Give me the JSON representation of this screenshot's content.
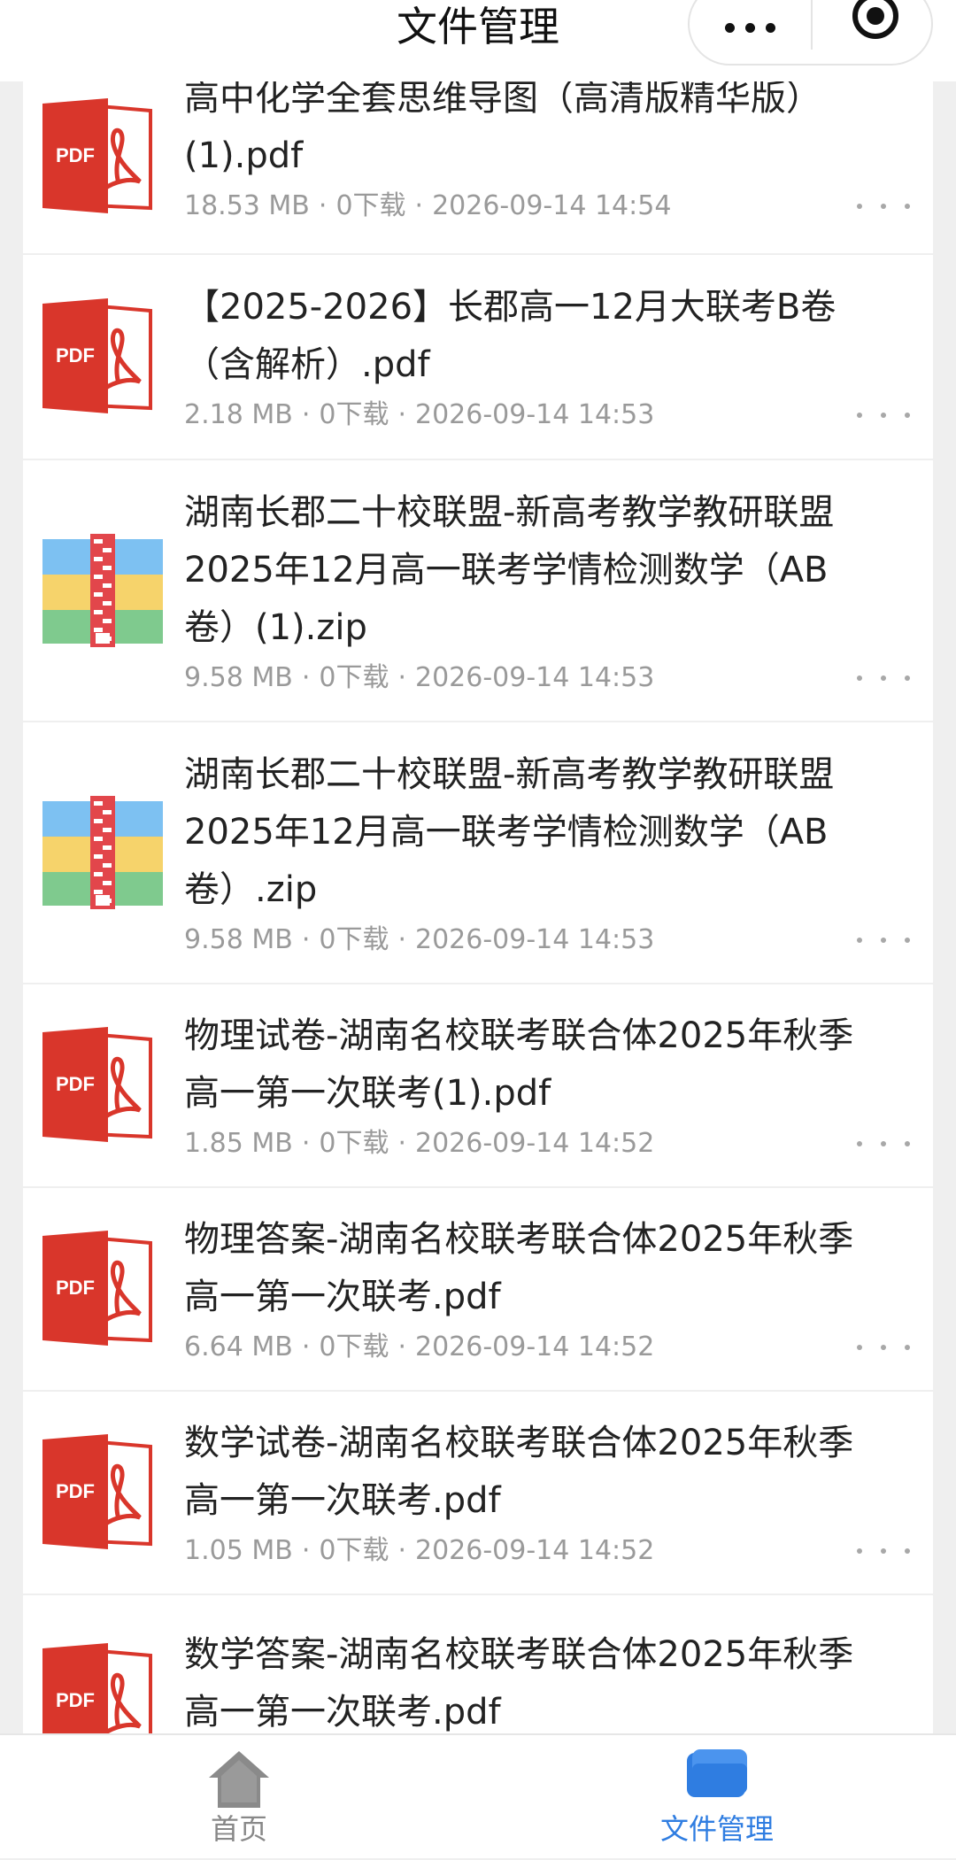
{
  "header": {
    "title": "文件管理",
    "menu_icon": "more-dots-icon",
    "close_icon": "target-circle-icon"
  },
  "files": [
    {
      "name_line1": "高中化学全套思维导图（高清版精华版）",
      "name_line2": "(1).pdf",
      "name_line3": "",
      "size": "18.53 MB",
      "downloads": "0下载",
      "datetime": "2026-09-14 14:54",
      "type": "pdf"
    },
    {
      "name_line1": "【2025-2026】长郡高一12月大联考B卷",
      "name_line2": "（含解析）.pdf",
      "name_line3": "",
      "size": "2.18 MB",
      "downloads": "0下载",
      "datetime": "2026-09-14 14:53",
      "type": "pdf"
    },
    {
      "name_line1": "湖南长郡二十校联盟-新高考教学教研联盟",
      "name_line2": "2025年12月高一联考学情检测数学（AB",
      "name_line3": "卷）(1).zip",
      "size": "9.58 MB",
      "downloads": "0下载",
      "datetime": "2026-09-14 14:53",
      "type": "zip"
    },
    {
      "name_line1": "湖南长郡二十校联盟-新高考教学教研联盟",
      "name_line2": "2025年12月高一联考学情检测数学（AB",
      "name_line3": "卷）.zip",
      "size": "9.58 MB",
      "downloads": "0下载",
      "datetime": "2026-09-14 14:53",
      "type": "zip"
    },
    {
      "name_line1": "物理试卷-湖南名校联考联合体2025年秋季",
      "name_line2": "高一第一次联考(1).pdf",
      "name_line3": "",
      "size": "1.85 MB",
      "downloads": "0下载",
      "datetime": "2026-09-14 14:52",
      "type": "pdf"
    },
    {
      "name_line1": "物理答案-湖南名校联考联合体2025年秋季",
      "name_line2": "高一第一次联考.pdf",
      "name_line3": "",
      "size": "6.64 MB",
      "downloads": "0下载",
      "datetime": "2026-09-14 14:52",
      "type": "pdf"
    },
    {
      "name_line1": "数学试卷-湖南名校联考联合体2025年秋季",
      "name_line2": "高一第一次联考.pdf",
      "name_line3": "",
      "size": "1.05 MB",
      "downloads": "0下载",
      "datetime": "2026-09-14 14:52",
      "type": "pdf"
    },
    {
      "name_line1": "数学答案-湖南名校联考联合体2025年秋季",
      "name_line2": "高一第一次联考.pdf",
      "name_line3": "",
      "size": "",
      "downloads": "",
      "datetime": "",
      "type": "pdf"
    }
  ],
  "pdf_badge": "PDF",
  "meta_separator": "·",
  "tabbar": {
    "home_label": "首页",
    "files_label": "文件管理",
    "active_color": "#2f7de1",
    "inactive_color": "#888888"
  },
  "colors": {
    "pdf_red": "#d9362b",
    "zip_blue": "#7dc1f2",
    "zip_yellow": "#f6d36b",
    "zip_green": "#7fca8e"
  }
}
